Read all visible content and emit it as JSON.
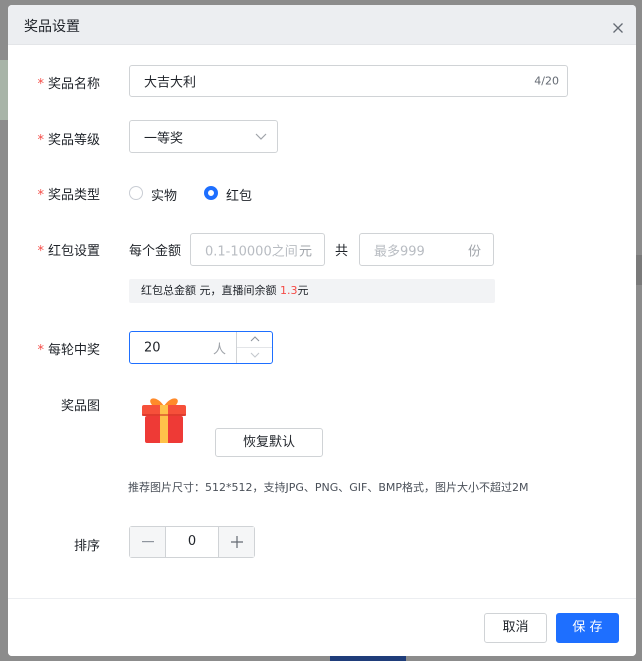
{
  "dialog": {
    "title": "奖品设置",
    "close_icon": "close-icon"
  },
  "form": {
    "name": {
      "label": "奖品名称",
      "value": "大吉大利",
      "count": "4/20"
    },
    "level": {
      "label": "奖品等级",
      "value": "一等奖"
    },
    "type": {
      "label": "奖品类型",
      "options": [
        {
          "label": "实物",
          "checked": false
        },
        {
          "label": "红包",
          "checked": true
        }
      ]
    },
    "redpacket": {
      "label": "红包设置",
      "per_amount_label": "每个金额",
      "amount_placeholder": "0.1-10000之间",
      "amount_unit": "元",
      "total_label": "共",
      "count_placeholder": "最多999",
      "count_unit": "份",
      "info_prefix": "红包总金额 元，直播间余额",
      "balance": "1.3",
      "balance_unit": "元"
    },
    "winners": {
      "label": "每轮中奖",
      "value": "20",
      "unit": "人"
    },
    "image": {
      "label": "奖品图",
      "icon": "gift-icon",
      "reset_button": "恢复默认",
      "hint": "推荐图片尺寸：512*512，支持JPG、PNG、GIF、BMP格式，图片大小不超过2M"
    },
    "sort": {
      "label": "排序",
      "value": "0"
    }
  },
  "footer": {
    "cancel": "取消",
    "save": "保 存"
  },
  "colors": {
    "primary": "#1e6fff",
    "required": "#f54a45"
  }
}
